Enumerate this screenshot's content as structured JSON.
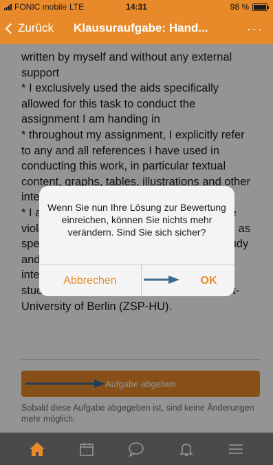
{
  "status_bar": {
    "carrier": "FONIC mobile",
    "network": "LTE",
    "time": "14:31",
    "battery": "98 %",
    "battery_level": 0.98
  },
  "nav": {
    "back_label": "Zurück",
    "title": "Klausuraufgabe: Hand...",
    "more_label": "···"
  },
  "document": {
    "lines": [
      "written by myself and without any external support",
      "* I exclusively used the aids specifically allowed for this task to conduct the assignment I am handing in",
      "* throughout my assignment, I explicitly refer to any and all references I have used in conducting this work, in particular textual content, graphs, tables, illustrations and other internal and external content and literature",
      "* I am aware of the consequences of these violations and the potential consequences, as specified and set up on the basis of the study and examination regulations and/or the interdisciplinary regulations of admission, studies, and examinations at the Humboldt-University of Berlin (ZSP-HU)."
    ]
  },
  "submit": {
    "label": "Aufgabe abgeben",
    "hint": "Sobald diese Aufgabe abgegeben ist, sind keine Änderungen mehr möglich."
  },
  "dialog": {
    "message": "Wenn Sie nun Ihre Lösung zur Bewertung einreichen, können Sie nichts mehr verändern. Sind Sie sich sicher?",
    "cancel_label": "Abbrechen",
    "ok_label": "OK"
  },
  "tab_bar": {
    "items": [
      {
        "icon": "home-icon",
        "active": true
      },
      {
        "icon": "calendar-icon",
        "active": false
      },
      {
        "icon": "chat-icon",
        "active": false
      },
      {
        "icon": "bell-icon",
        "active": false
      },
      {
        "icon": "menu-icon",
        "active": false
      }
    ]
  },
  "colors": {
    "accent": "#e88a2a",
    "tab_bar_bg": "#4a4a4a",
    "arrow": "#3a6b91"
  }
}
